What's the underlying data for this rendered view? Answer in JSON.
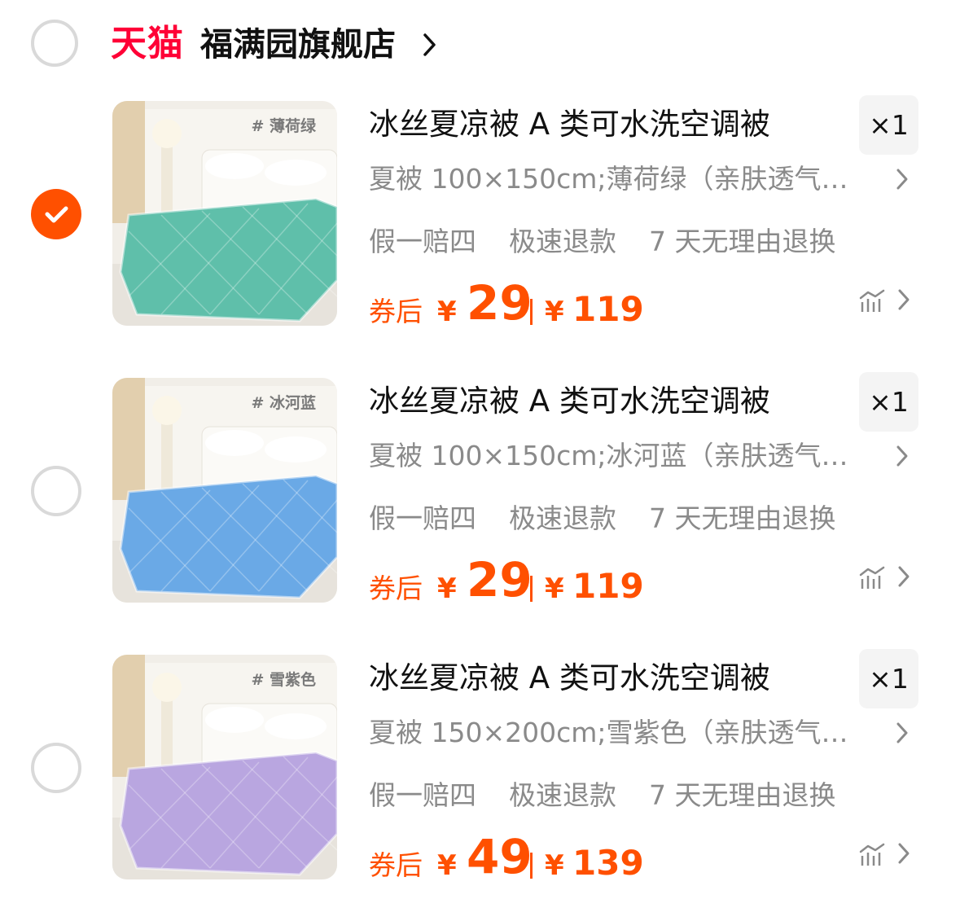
{
  "shop": {
    "brand": "天猫",
    "name": "福满园旗舰店"
  },
  "items": [
    {
      "selected": true,
      "tag": "# 薄荷绿",
      "title": "冰丝夏凉被 A 类可水洗空调被",
      "qty": "×1",
      "sku": "夏被 100×150cm;薄荷绿（亲肤透气…",
      "services": [
        "假一赔四",
        "极速退款",
        "7 天无理由退换"
      ],
      "coupon_label": "券后",
      "currency": "¥",
      "price_after": "29",
      "price_orig": "119",
      "color": "#5fbfaa"
    },
    {
      "selected": false,
      "tag": "# 冰河蓝",
      "title": "冰丝夏凉被 A 类可水洗空调被",
      "qty": "×1",
      "sku": "夏被 100×150cm;冰河蓝（亲肤透气…",
      "services": [
        "假一赔四",
        "极速退款",
        "7 天无理由退换"
      ],
      "coupon_label": "券后",
      "currency": "¥",
      "price_after": "29",
      "price_orig": "119",
      "color": "#6aa9e6"
    },
    {
      "selected": false,
      "tag": "# 雪紫色",
      "title": "冰丝夏凉被 A 类可水洗空调被",
      "qty": "×1",
      "sku": "夏被 150×200cm;雪紫色（亲肤透气…",
      "services": [
        "假一赔四",
        "极速退款",
        "7 天无理由退换"
      ],
      "coupon_label": "券后",
      "currency": "¥",
      "price_after": "49",
      "price_orig": "139",
      "color": "#b9a6e0"
    }
  ]
}
